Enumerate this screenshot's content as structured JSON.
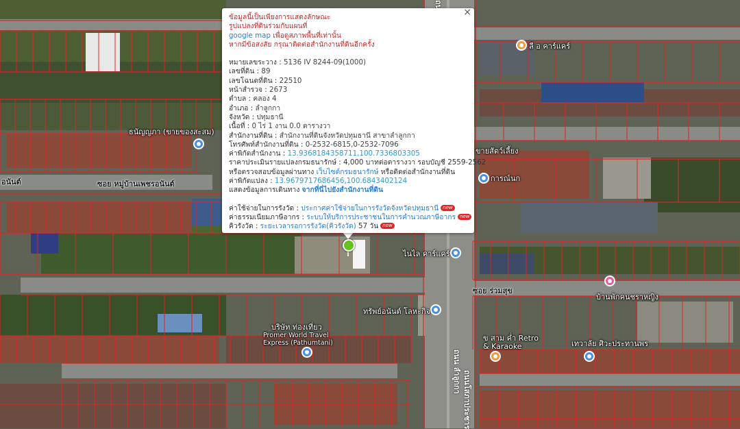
{
  "popup": {
    "disclaimer": [
      "ข้อมูลนี้เป็นเพียงการแสดงลักษณะ",
      "รูปแปลงที่ดินร่วมกับแผนที่",
      "google map",
      "เพื่อดูสภาพพื้นที่เท่านั้น",
      "หากมีข้อสงสัย กรุณาติดต่อสำนักงานที่ดินอีกครั้ง"
    ],
    "fields": [
      {
        "label": "หมายเลขระวาง",
        "value": "5136 IV 8244-09(1000)"
      },
      {
        "label": "เลขที่ดิน",
        "value": "89"
      },
      {
        "label": "เลขโฉนดที่ดิน",
        "value": "22510"
      },
      {
        "label": "หน้าสำรวจ",
        "value": "2673"
      },
      {
        "label": "ตำบล",
        "value": "คลอง 4"
      },
      {
        "label": "อำเภอ",
        "value": "ลำลูกกา"
      },
      {
        "label": "จังหวัด",
        "value": "ปทุมธานี"
      },
      {
        "label": "เนื้อที่",
        "value": "0 ไร่ 1 งาน 0.0 ตารางวา"
      },
      {
        "label": "สำนักงานที่ดิน",
        "value": "สำนักงานที่ดินจังหวัดปทุมธานี สาขาลำลูกกา"
      },
      {
        "label": "โทรศัพท์สำนักงานที่ดิน",
        "value": "0-2532-6815,0-2532-7096"
      }
    ],
    "office_coord_label": "ค่าพิกัดสำนักงาน",
    "office_coord": "13.9368184358711,100.7336803305",
    "price_line": "ราคาประเมินรายแปลงกรมธนารักษ์ : 4,000 บาทต่อตารางวา รอบบัญชี 2559-2562",
    "verify_prefix": "หรือตรวจสอบข้อมูลผ่านทาง",
    "verify_link": "เว็บไซต์กรมธนารักษ์",
    "verify_suffix": "หรือติดต่อสำนักงานที่ดิน",
    "parcel_coord_label": "ค่าพิกัดแปลง",
    "parcel_coord": "13.9679717686456,100.6843402124",
    "route_prefix": "แสดงข้อมูลการเดินทาง",
    "route_link": "จากที่นี่ไปยังสำนักงานที่ดิน",
    "fee_label": "ค่าใช้จ่ายในการรังวัด",
    "fee_link": "ประกาศค่าใช้จ่ายในการรังวัดจังหวัดปทุมธานี",
    "tax_label": "ค่าธรรมเนียมภาษีอากร",
    "tax_link": "ระบบให้บริการประชาชนในการคำนวณภาษีอากร",
    "queue_label": "คิวรังวัด",
    "queue_link": "ระยะเวลารอการรังวัด(คิวรังวัด)",
    "queue_days": "57 วัน",
    "new_badge": "new",
    "close": "×"
  },
  "map_labels": {
    "poi_top_right": "ลี อ คาร์แคร์",
    "poi_left": "ธนัญญภา (ขายของสะสม)",
    "road_left_partial": "อนันต์",
    "road_left": "ซอย หมู่บ้านเพชรอนันต์",
    "poi_pet_shop_partial": "ขายสัตว์เลี้ยง",
    "poi_kanok": "การณ์นก",
    "poi_car_care": "ไนไล คาร์แคร์",
    "road_ruamsuk": "ซอย ร่วมสุข",
    "poi_house": "บ้านพักคนชราหญิง",
    "poi_travel_thai": "บริษัท ท่องเที่ยว",
    "poi_travel_en": "Promer World Travel Express (Pathumtani)",
    "poi_property": "ทรัพย์อนันต์ โลหะกิจ",
    "poi_karaoke_1": "ข สาม ค่ำ Retro",
    "poi_karaoke_2": "& Karaoke",
    "poi_cafe": "เทวาลัย ศิวะประทานพร",
    "road_main_1": "ถนน ลำลูกกา",
    "road_main_2": "ถนนโสภาประชาร",
    "road_top_partial": "ถนน"
  },
  "colors": {
    "parcel_line": "#e02424",
    "poi_blue": "#4a8fe0",
    "poi_orange": "#f09a3e",
    "poi_pink": "#e85aa6",
    "marker": "#63c21b"
  },
  "icons": [
    "close-icon",
    "location-marker-icon",
    "poi-pin-icon"
  ]
}
